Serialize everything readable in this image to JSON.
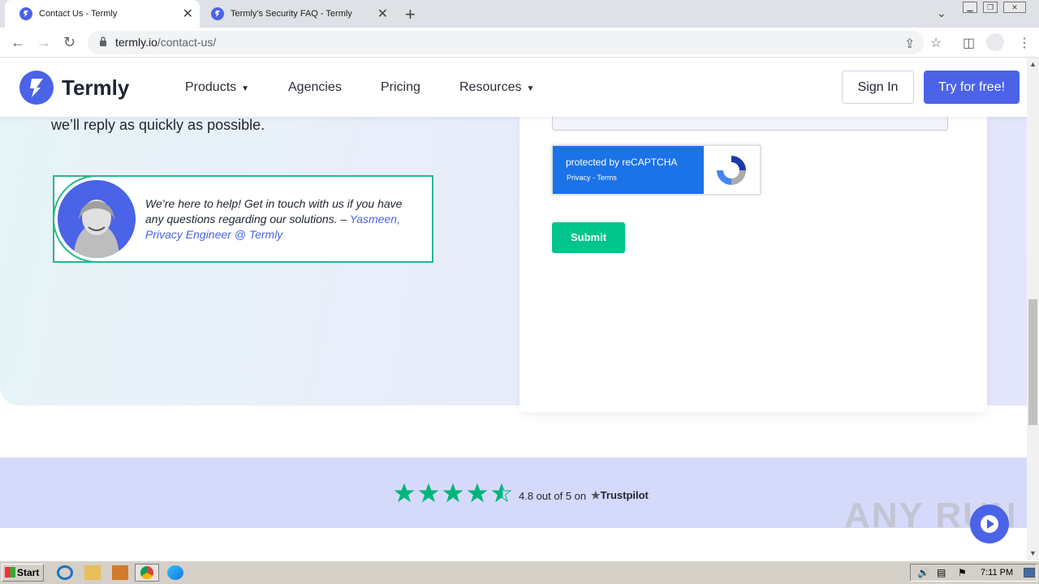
{
  "browser": {
    "tabs": [
      {
        "title": "Contact Us - Termly",
        "active": true
      },
      {
        "title": "Termly's Security FAQ - Termly",
        "active": false
      }
    ],
    "new_tab": "+",
    "url_domain": "termly.io",
    "url_path": "/contact-us/"
  },
  "header": {
    "brand": "Termly",
    "nav": [
      {
        "label": "Products",
        "dropdown": true
      },
      {
        "label": "Agencies",
        "dropdown": false
      },
      {
        "label": "Pricing",
        "dropdown": false
      },
      {
        "label": "Resources",
        "dropdown": true
      }
    ],
    "sign_in": "Sign In",
    "try_free": "Try for free!"
  },
  "hero": {
    "intro_tail": "we’ll reply as quickly as possible.",
    "quote": "We’re here to help! Get in touch with us if you have any questions regarding our solutions. – ",
    "quote_author": "Yasmeen, Privacy Engineer @ Termly"
  },
  "form": {
    "recaptcha_line1": "protected by reCAPTCHA",
    "recaptcha_line2": "Privacy - Terms",
    "submit_label": "Submit"
  },
  "trustpilot": {
    "rating_text": "4.8 out of 5 on",
    "brand": "Trustpilot",
    "stars": 4.8,
    "star_color": "#00b67a"
  },
  "watermark": "ANY RUN",
  "taskbar": {
    "start_label": "Start",
    "clock": "7:11 PM"
  },
  "colors": {
    "brand_blue": "#4a63e7",
    "accent_green": "#00c58c"
  }
}
